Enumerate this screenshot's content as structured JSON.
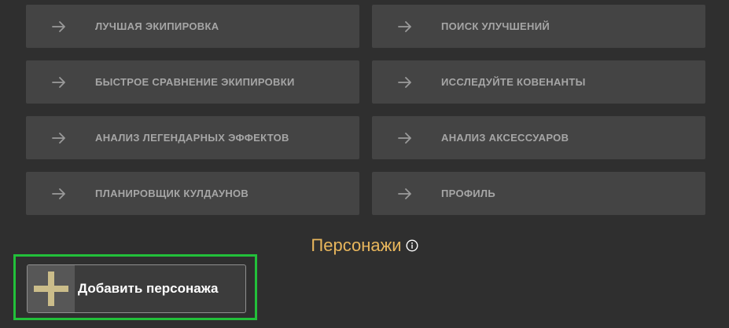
{
  "nav": {
    "items": [
      {
        "label": "ЛУЧШАЯ ЭКИПИРОВКА",
        "icon": "arrow-right-icon"
      },
      {
        "label": "ПОИСК УЛУЧШЕНИЙ",
        "icon": "arrow-right-icon"
      },
      {
        "label": "БЫСТРОЕ СРАВНЕНИЕ ЭКИПИРОВКИ",
        "icon": "arrow-right-icon"
      },
      {
        "label": "ИССЛЕДУЙТЕ КОВЕНАНТЫ",
        "icon": "arrow-right-icon"
      },
      {
        "label": "АНАЛИЗ ЛЕГЕНДАРНЫХ ЭФФЕКТОВ",
        "icon": "arrow-right-icon"
      },
      {
        "label": "АНАЛИЗ АКСЕССУАРОВ",
        "icon": "arrow-right-icon"
      },
      {
        "label": "ПЛАНИРОВЩИК КУЛДАУНОВ",
        "icon": "arrow-right-icon"
      },
      {
        "label": "ПРОФИЛЬ",
        "icon": "arrow-right-icon"
      }
    ]
  },
  "characters": {
    "title": "Персонажи",
    "info_icon": "info-circle-icon",
    "add_button_label": "Добавить персонажа",
    "add_icon": "plus-icon"
  },
  "colors": {
    "background": "#2f2f2f",
    "button_bg": "#444444",
    "button_text": "#a6a6a6",
    "title_accent": "#e8b65c",
    "highlight_border": "#22c03a",
    "plus_color": "#cbbd8a"
  }
}
